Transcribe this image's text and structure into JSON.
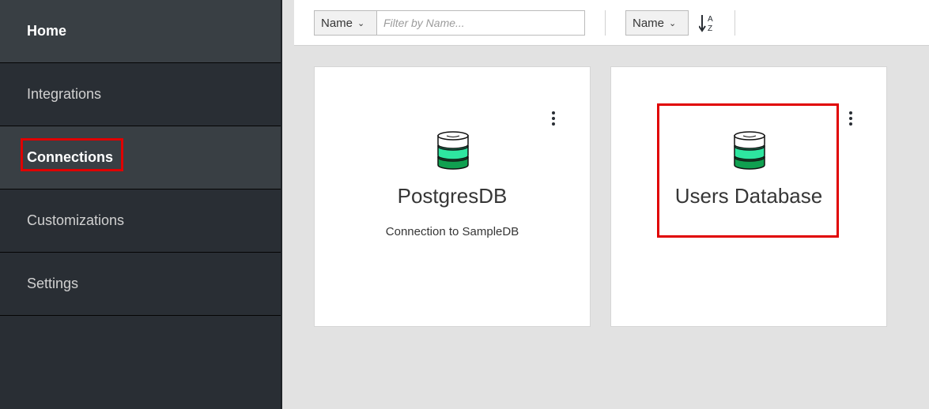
{
  "sidebar": {
    "items": [
      {
        "label": "Home"
      },
      {
        "label": "Integrations"
      },
      {
        "label": "Connections"
      },
      {
        "label": "Customizations"
      },
      {
        "label": "Settings"
      }
    ]
  },
  "toolbar": {
    "filter_field": "Name",
    "filter_placeholder": "Filter by Name...",
    "sort_field": "Name",
    "sort_icon": "sort-alpha-asc-icon"
  },
  "cards": [
    {
      "title": "PostgresDB",
      "description": "Connection to SampleDB",
      "icon": "database-icon"
    },
    {
      "title": "Users Database",
      "description": "",
      "icon": "database-icon"
    }
  ],
  "colors": {
    "highlight": "#e00000",
    "db_green_light": "#2ee6a0",
    "db_green_dark": "#10a050"
  }
}
